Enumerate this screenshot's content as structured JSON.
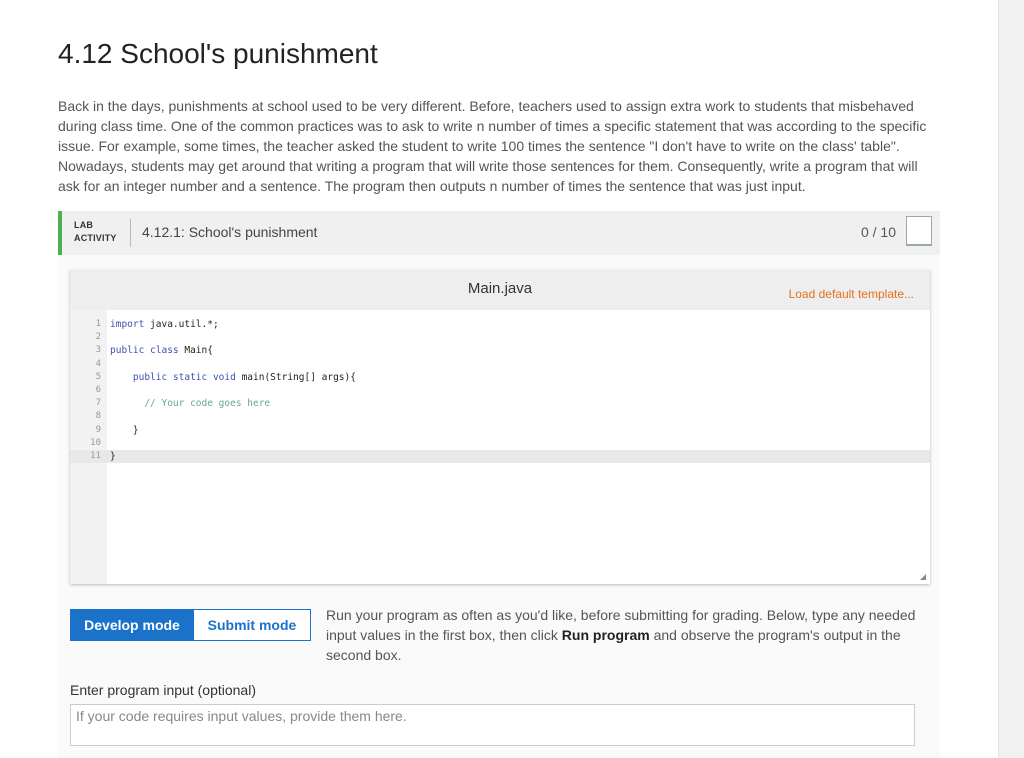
{
  "section": {
    "title": "4.12 School's punishment",
    "description": "Back in the days, punishments at school used to be very different. Before, teachers used to assign extra work to students that misbehaved during class time. One of the common practices was to ask to write n number of times a specific statement that was according to the specific issue. For example, some times, the teacher asked the student to write 100 times the sentence \"I don't have to write on the class' table\". Nowadays, students may get around that writing a program that will write those sentences for them. Consequently, write a program that will ask for an integer number and a sentence. The program then outputs n number of times the sentence that was just input."
  },
  "lab": {
    "tag_line1": "LAB",
    "tag_line2": "ACTIVITY",
    "title": "4.12.1: School's punishment",
    "score": "0 / 10",
    "accent_color": "#4caf50"
  },
  "editor": {
    "file_name": "Main.java",
    "load_template": "Load default template...",
    "lines": [
      {
        "n": "1",
        "parts": [
          [
            "kw",
            "import"
          ],
          [
            "",
            " java.util.*;"
          ]
        ]
      },
      {
        "n": "2",
        "parts": []
      },
      {
        "n": "3",
        "parts": [
          [
            "kw",
            "public class"
          ],
          [
            "",
            " Main{"
          ]
        ]
      },
      {
        "n": "4",
        "parts": []
      },
      {
        "n": "5",
        "parts": [
          [
            "",
            "    "
          ],
          [
            "kw",
            "public static void"
          ],
          [
            "",
            " main(String[] args){"
          ]
        ]
      },
      {
        "n": "6",
        "parts": []
      },
      {
        "n": "7",
        "parts": [
          [
            "",
            "      "
          ],
          [
            "cm",
            "// Your code goes here"
          ]
        ]
      },
      {
        "n": "8",
        "parts": []
      },
      {
        "n": "9",
        "parts": [
          [
            "",
            "    }"
          ]
        ]
      },
      {
        "n": "10",
        "parts": []
      },
      {
        "n": "11",
        "parts": [
          [
            "",
            "}"
          ]
        ],
        "active": true
      }
    ]
  },
  "modes": {
    "develop": "Develop mode",
    "submit": "Submit mode",
    "active": "develop",
    "info_before": "Run your program as often as you'd like, before submitting for grading. Below, type any needed input values in the first box, then click ",
    "info_bold": "Run program",
    "info_after": " and observe the program's output in the second box."
  },
  "input": {
    "label": "Enter program input (optional)",
    "placeholder": "If your code requires input values, provide them here.",
    "value": ""
  },
  "colors": {
    "primary": "#1a73c8",
    "link_orange": "#e6711c"
  }
}
